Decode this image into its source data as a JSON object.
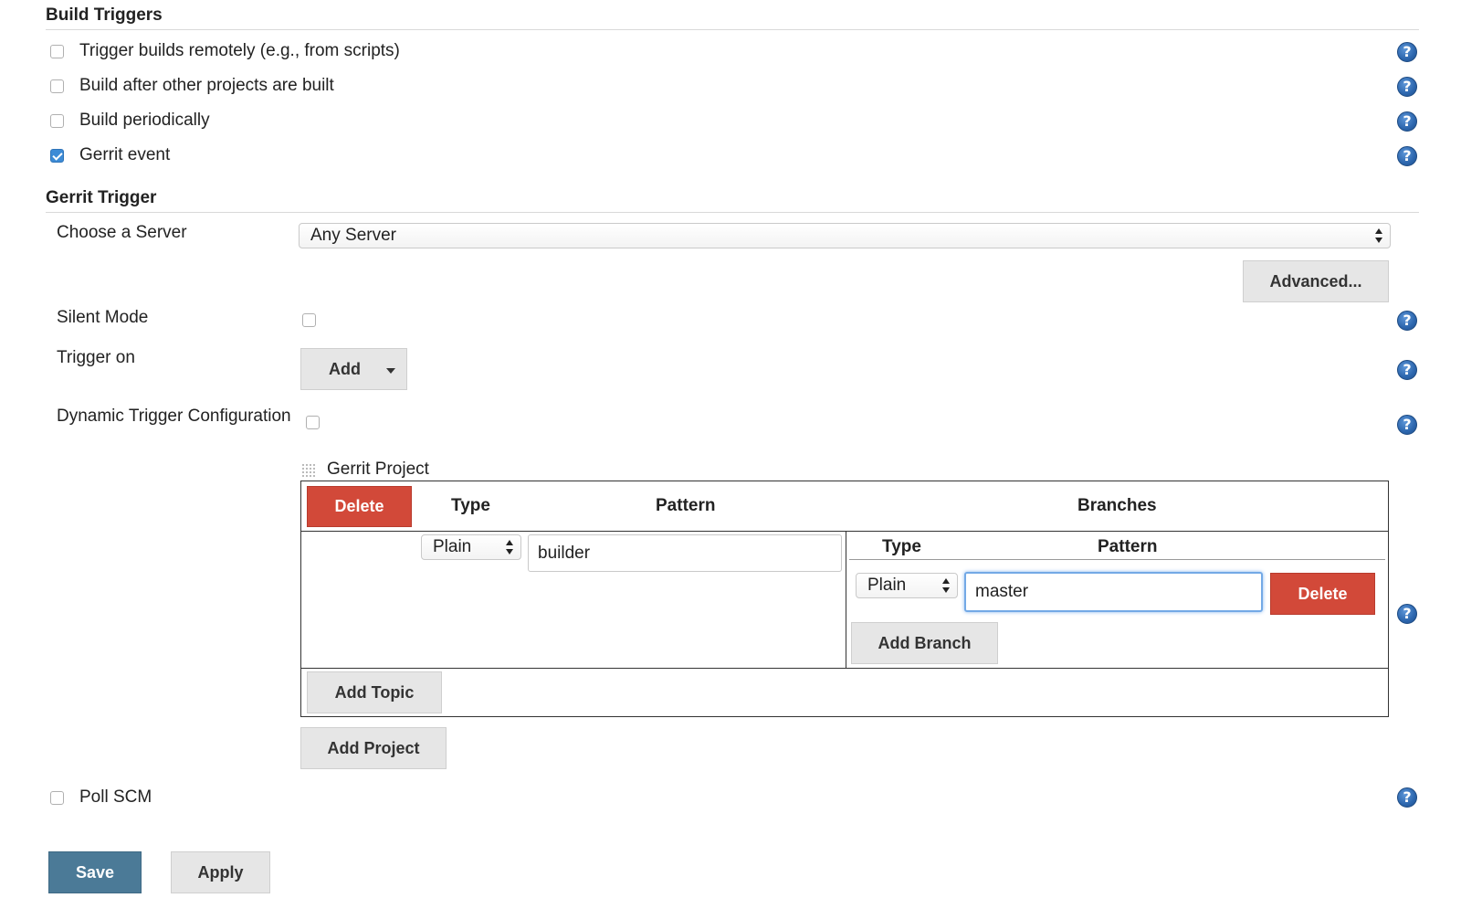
{
  "build_triggers": {
    "title": "Build Triggers",
    "options": [
      {
        "label": "Trigger builds remotely (e.g., from scripts)",
        "checked": false
      },
      {
        "label": "Build after other projects are built",
        "checked": false
      },
      {
        "label": "Build periodically",
        "checked": false
      },
      {
        "label": "Gerrit event",
        "checked": true
      }
    ],
    "poll_scm": {
      "label": "Poll SCM",
      "checked": false
    }
  },
  "gerrit_trigger": {
    "title": "Gerrit Trigger",
    "choose_server_label": "Choose a Server",
    "server_selected": "Any Server",
    "advanced_button": "Advanced...",
    "silent_mode_label": "Silent Mode",
    "trigger_on_label": "Trigger on",
    "add_button": "Add",
    "dynamic_config_label": "Dynamic Trigger Configuration",
    "gerrit_project": {
      "header": "Gerrit Project",
      "delete_button": "Delete",
      "type_header": "Type",
      "pattern_header": "Pattern",
      "branches_header": "Branches",
      "project_type": "Plain",
      "project_pattern": "builder",
      "branches": {
        "type_header": "Type",
        "pattern_header": "Pattern",
        "type_value": "Plain",
        "pattern_value": "master",
        "delete_button": "Delete",
        "add_branch_button": "Add Branch"
      },
      "add_topic_button": "Add Topic"
    },
    "add_project_button": "Add Project"
  },
  "footer": {
    "save_button": "Save",
    "apply_button": "Apply"
  },
  "help_icon_glyph": "?"
}
